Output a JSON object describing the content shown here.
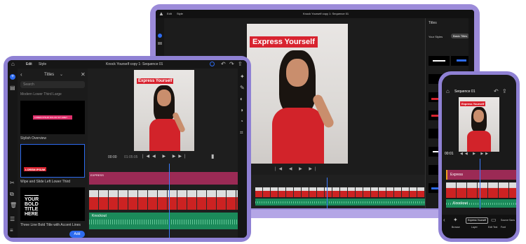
{
  "overlay_title": "Express Yourself",
  "laptop": {
    "window_title": "Knock Yourself copy 1: Sequence 01",
    "panel_title": "Titles",
    "tabs": [
      "Edit",
      "Style"
    ],
    "panel_buttons": [
      "Your Styles",
      "Basic Titles"
    ],
    "track_label": "Express"
  },
  "tablet": {
    "tabs": [
      "Edit",
      "Style"
    ],
    "sequence_title": "Knock Yourself copy 1: Sequence 01",
    "panel_title": "Titles",
    "search_placeholder": "Search",
    "templates": [
      {
        "caption": "Modern Lower Third Large",
        "thumb_text": ""
      },
      {
        "caption": "Stylish Overview",
        "thumb_text": "LOREM IPSUM DOLOR SIT AMET"
      },
      {
        "caption": "Wipe and Slide Left Lower Third",
        "thumb_text": "LOREM IPSUM"
      },
      {
        "caption": "Three Line Bold Title with Accent Lines",
        "thumb_text": "YOUR BOLD TITLE HERE"
      }
    ],
    "add_button": "Add",
    "timecode_current": "00:00",
    "timecode_total": "01:05:05",
    "title_track_label": "EXPRESS",
    "audio_track_label": "Knockout"
  },
  "phone": {
    "sequence_title": "Sequence 01",
    "timecode": "00:01",
    "track_label": "Express",
    "audio_label": "Knockout",
    "tooltip": "Express Yourself",
    "bottom_items": [
      "Browse",
      "Layer",
      "Edit Text",
      "Font",
      "Source Sans"
    ]
  },
  "colors": {
    "device_purple": "#9c8bd9",
    "accent_blue": "#2d6bf0",
    "title_red": "#d8232f",
    "track_pink": "#9b2a55",
    "audio_green": "#1b8a5a"
  }
}
